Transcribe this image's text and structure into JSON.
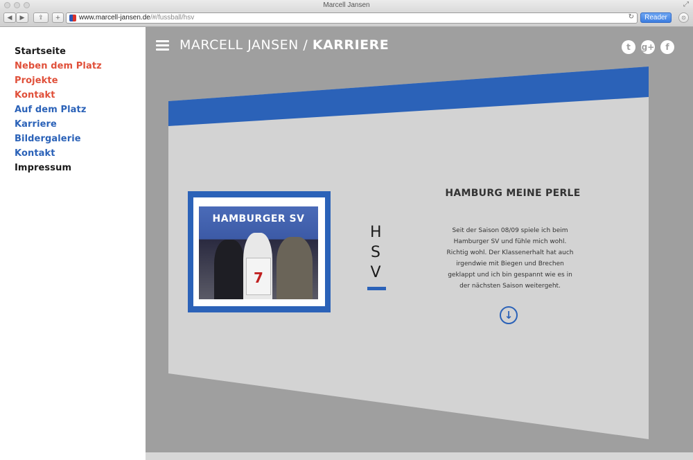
{
  "window": {
    "title": "Marcell Jansen"
  },
  "browser": {
    "url_domain": "www.marcell-jansen.de",
    "url_path": "/#/fussball/hsv",
    "reader_label": "Reader"
  },
  "sidebar": {
    "items": [
      {
        "label": "Startseite",
        "color": "#1a1a1a"
      },
      {
        "label": "Neben dem Platz",
        "color": "#e0503a"
      },
      {
        "label": "Projekte",
        "color": "#e0503a"
      },
      {
        "label": "Kontakt",
        "color": "#e0503a"
      },
      {
        "label": "Auf dem Platz",
        "color": "#2b62b8"
      },
      {
        "label": "Karriere",
        "color": "#2b62b8"
      },
      {
        "label": "Bildergalerie",
        "color": "#2b62b8"
      },
      {
        "label": "Kontakt",
        "color": "#2b62b8"
      },
      {
        "label": "Impressum",
        "color": "#1a1a1a"
      }
    ]
  },
  "header": {
    "title_light": "MARCELL JANSEN / ",
    "title_bold": "KARRIERE",
    "social": [
      "twitter-icon",
      "google-plus-icon",
      "facebook-icon"
    ]
  },
  "panel": {
    "photo_banner": "HAMBURGER SV",
    "shirt_number": "7",
    "letters": [
      "H",
      "S",
      "V"
    ],
    "heading": "HAMBURG MEINE PERLE",
    "text": "Seit der Saison 08/09 spiele ich beim Hamburger SV und fühle mich wohl. Richtig wohl. Der Klassenerhalt hat auch irgendwie mit Biegen und Brechen geklappt und ich bin gespannt wie es in der nächsten Saison weitergeht.",
    "accent_color": "#2b62b8"
  }
}
